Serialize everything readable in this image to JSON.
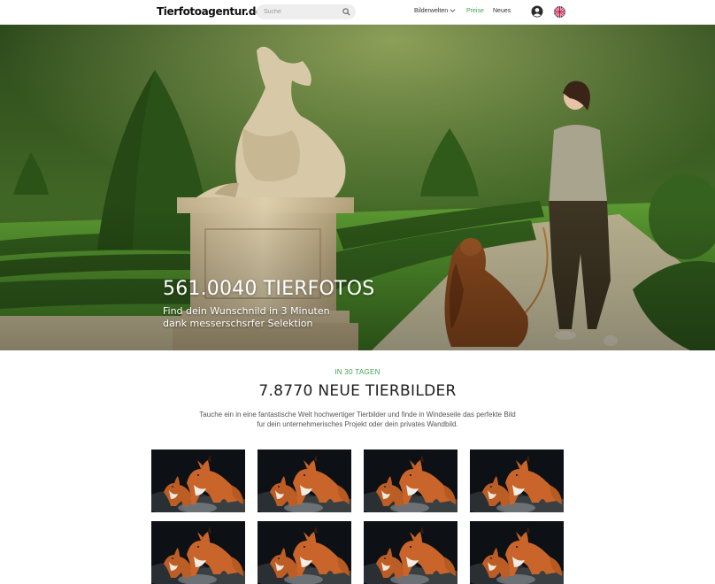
{
  "header": {
    "logo_text": "Tierfotoagentur.de",
    "search": {
      "placeholder": "Suche",
      "icon": "search-icon"
    },
    "nav": [
      {
        "label": "Bilderwelten",
        "has_dropdown": true,
        "active": false
      },
      {
        "label": "Preise",
        "has_dropdown": false,
        "active": true
      },
      {
        "label": "Neues",
        "has_dropdown": false,
        "active": false
      }
    ],
    "icons": [
      "user-account-icon",
      "uk-flag-icon"
    ]
  },
  "hero": {
    "title": "561.0040 TIERFOTOS",
    "subtitle_line1": "Find dein Wunschnild in 3 Minuten",
    "subtitle_line2": "dank messerschsrfer Selektion"
  },
  "section": {
    "kicker": "IN 30 TAGEN",
    "title": "7.8770 NEUE TIERBILDER",
    "desc_line1": "Tauche ein in eine fantastische Welt hochwertiger Tierbilder und finde in Windeseile das perfekte Bild",
    "desc_line2": "fur dein unternehmerisches Projekt oder dein privates Wandbild."
  },
  "gallery": {
    "tile_count": 8,
    "tile_subject": "fox-photo"
  },
  "colors": {
    "accent_green": "#3ea44c",
    "text_dark": "#1e1e1e",
    "tile_bg": "#0c0f12"
  }
}
